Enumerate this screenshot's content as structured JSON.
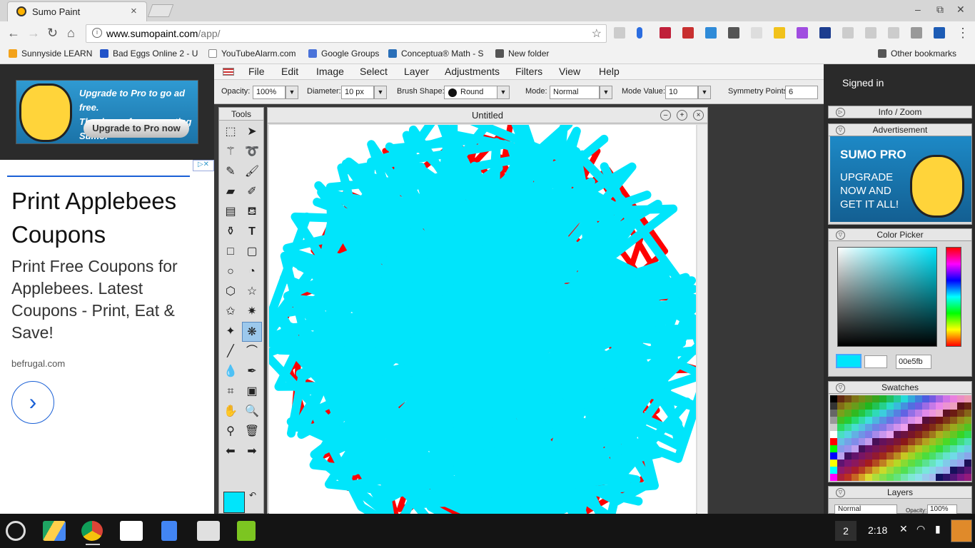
{
  "browser": {
    "tab_title": "Sumo Paint",
    "tab_close": "×",
    "url_host": "www.sumopaint.com",
    "url_path": "/app/",
    "window_controls": [
      "–",
      "⧉",
      "✕"
    ]
  },
  "bookmarks": [
    {
      "label": "Sunnyside LEARN",
      "icon": "flame-icon",
      "color": "#f3a21a"
    },
    {
      "label": "Bad Eggs Online 2 - U",
      "icon": "game-icon",
      "color": "#2153c9"
    },
    {
      "label": "YouTubeAlarm.com",
      "icon": "page-icon",
      "color": "#888888"
    },
    {
      "label": "Google Groups",
      "icon": "groups-icon",
      "color": "#4a73d9"
    },
    {
      "label": "Conceptua® Math - S",
      "icon": "c-icon",
      "color": "#2a6fb8"
    },
    {
      "label": "New folder",
      "icon": "folder-icon",
      "color": "#555555"
    }
  ],
  "other_bookmarks": "Other bookmarks",
  "left_ad": {
    "pro_line1": "Upgrade to Pro to go ad free.",
    "pro_line2": "Thank you for supporting Sumo!",
    "pro_button": "Upgrade to Pro now",
    "title": "Print Applebees Coupons",
    "description": "Print Free Coupons for Applebees. Latest Coupons - Print, Eat & Save!",
    "site": "befrugal.com"
  },
  "menu": [
    "File",
    "Edit",
    "Image",
    "Select",
    "Layer",
    "Adjustments",
    "Filters",
    "View",
    "Help"
  ],
  "options": {
    "opacity_label": "Opacity:",
    "opacity": "100%",
    "diameter_label": "Diameter:",
    "diameter": "10 px",
    "brush_shape_label": "Brush Shape:",
    "brush_shape": "Round",
    "mode_label": "Mode:",
    "mode": "Normal",
    "mode_value_label": "Mode Value:",
    "mode_value": "10",
    "symmetry_label": "Symmetry Points",
    "symmetry": "6"
  },
  "tools_title": "Tools",
  "document_title": "Untitled",
  "right_panel": {
    "signed_in": "Signed in",
    "info_zoom": "Info / Zoom",
    "advertisement": "Advertisement",
    "sumo_pro": "SUMO PRO",
    "sumo_pro_body": "UPGRADE NOW AND GET IT ALL!",
    "color_picker": "Color Picker",
    "hex": "00e5fb",
    "swatches": "Swatches",
    "layers": "Layers",
    "layer_mode": "Normal",
    "layer_opacity_label": "Opacity:",
    "layer_opacity": "100%"
  },
  "colors": {
    "primary": "#00e5fb",
    "stroke2": "#ff0000"
  },
  "shelf": {
    "badge": "2",
    "time": "2:18"
  }
}
